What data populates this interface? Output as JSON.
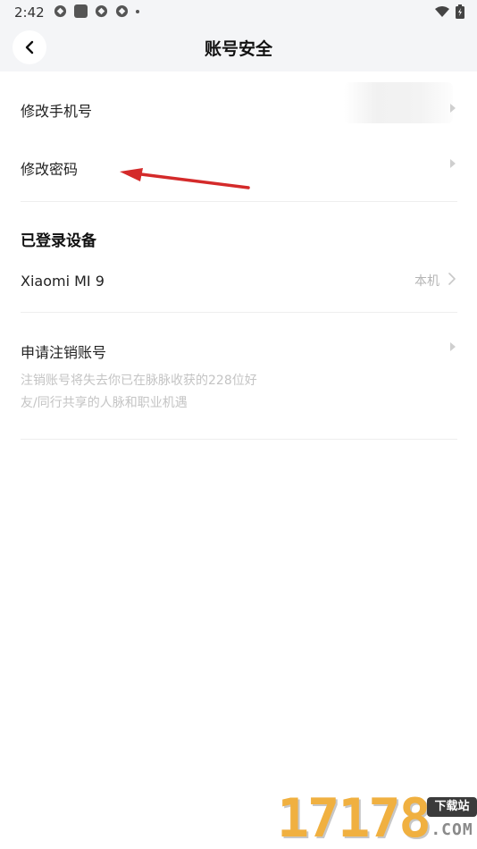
{
  "status_bar": {
    "time": "2:42"
  },
  "header": {
    "title": "账号安全",
    "back_icon": "chevron-left-icon"
  },
  "account": {
    "change_phone_label": "修改手机号",
    "change_password_label": "修改密码"
  },
  "devices": {
    "section_title": "已登录设备",
    "device_name": "Xiaomi MI 9",
    "device_note": "本机"
  },
  "deactivate": {
    "label": "申请注销账号",
    "description_line1": "注销账号将失去你已在脉脉收获的228位好",
    "description_line2": "友/同行共享的人脉和职业机遇"
  },
  "watermark": {
    "digits": "17178",
    "badge": "下载站",
    "domain": ".COM"
  },
  "colors": {
    "header_bg": "#f4f5f7",
    "annotation_arrow": "#d42a2a",
    "watermark_orange": "#f0b040"
  }
}
